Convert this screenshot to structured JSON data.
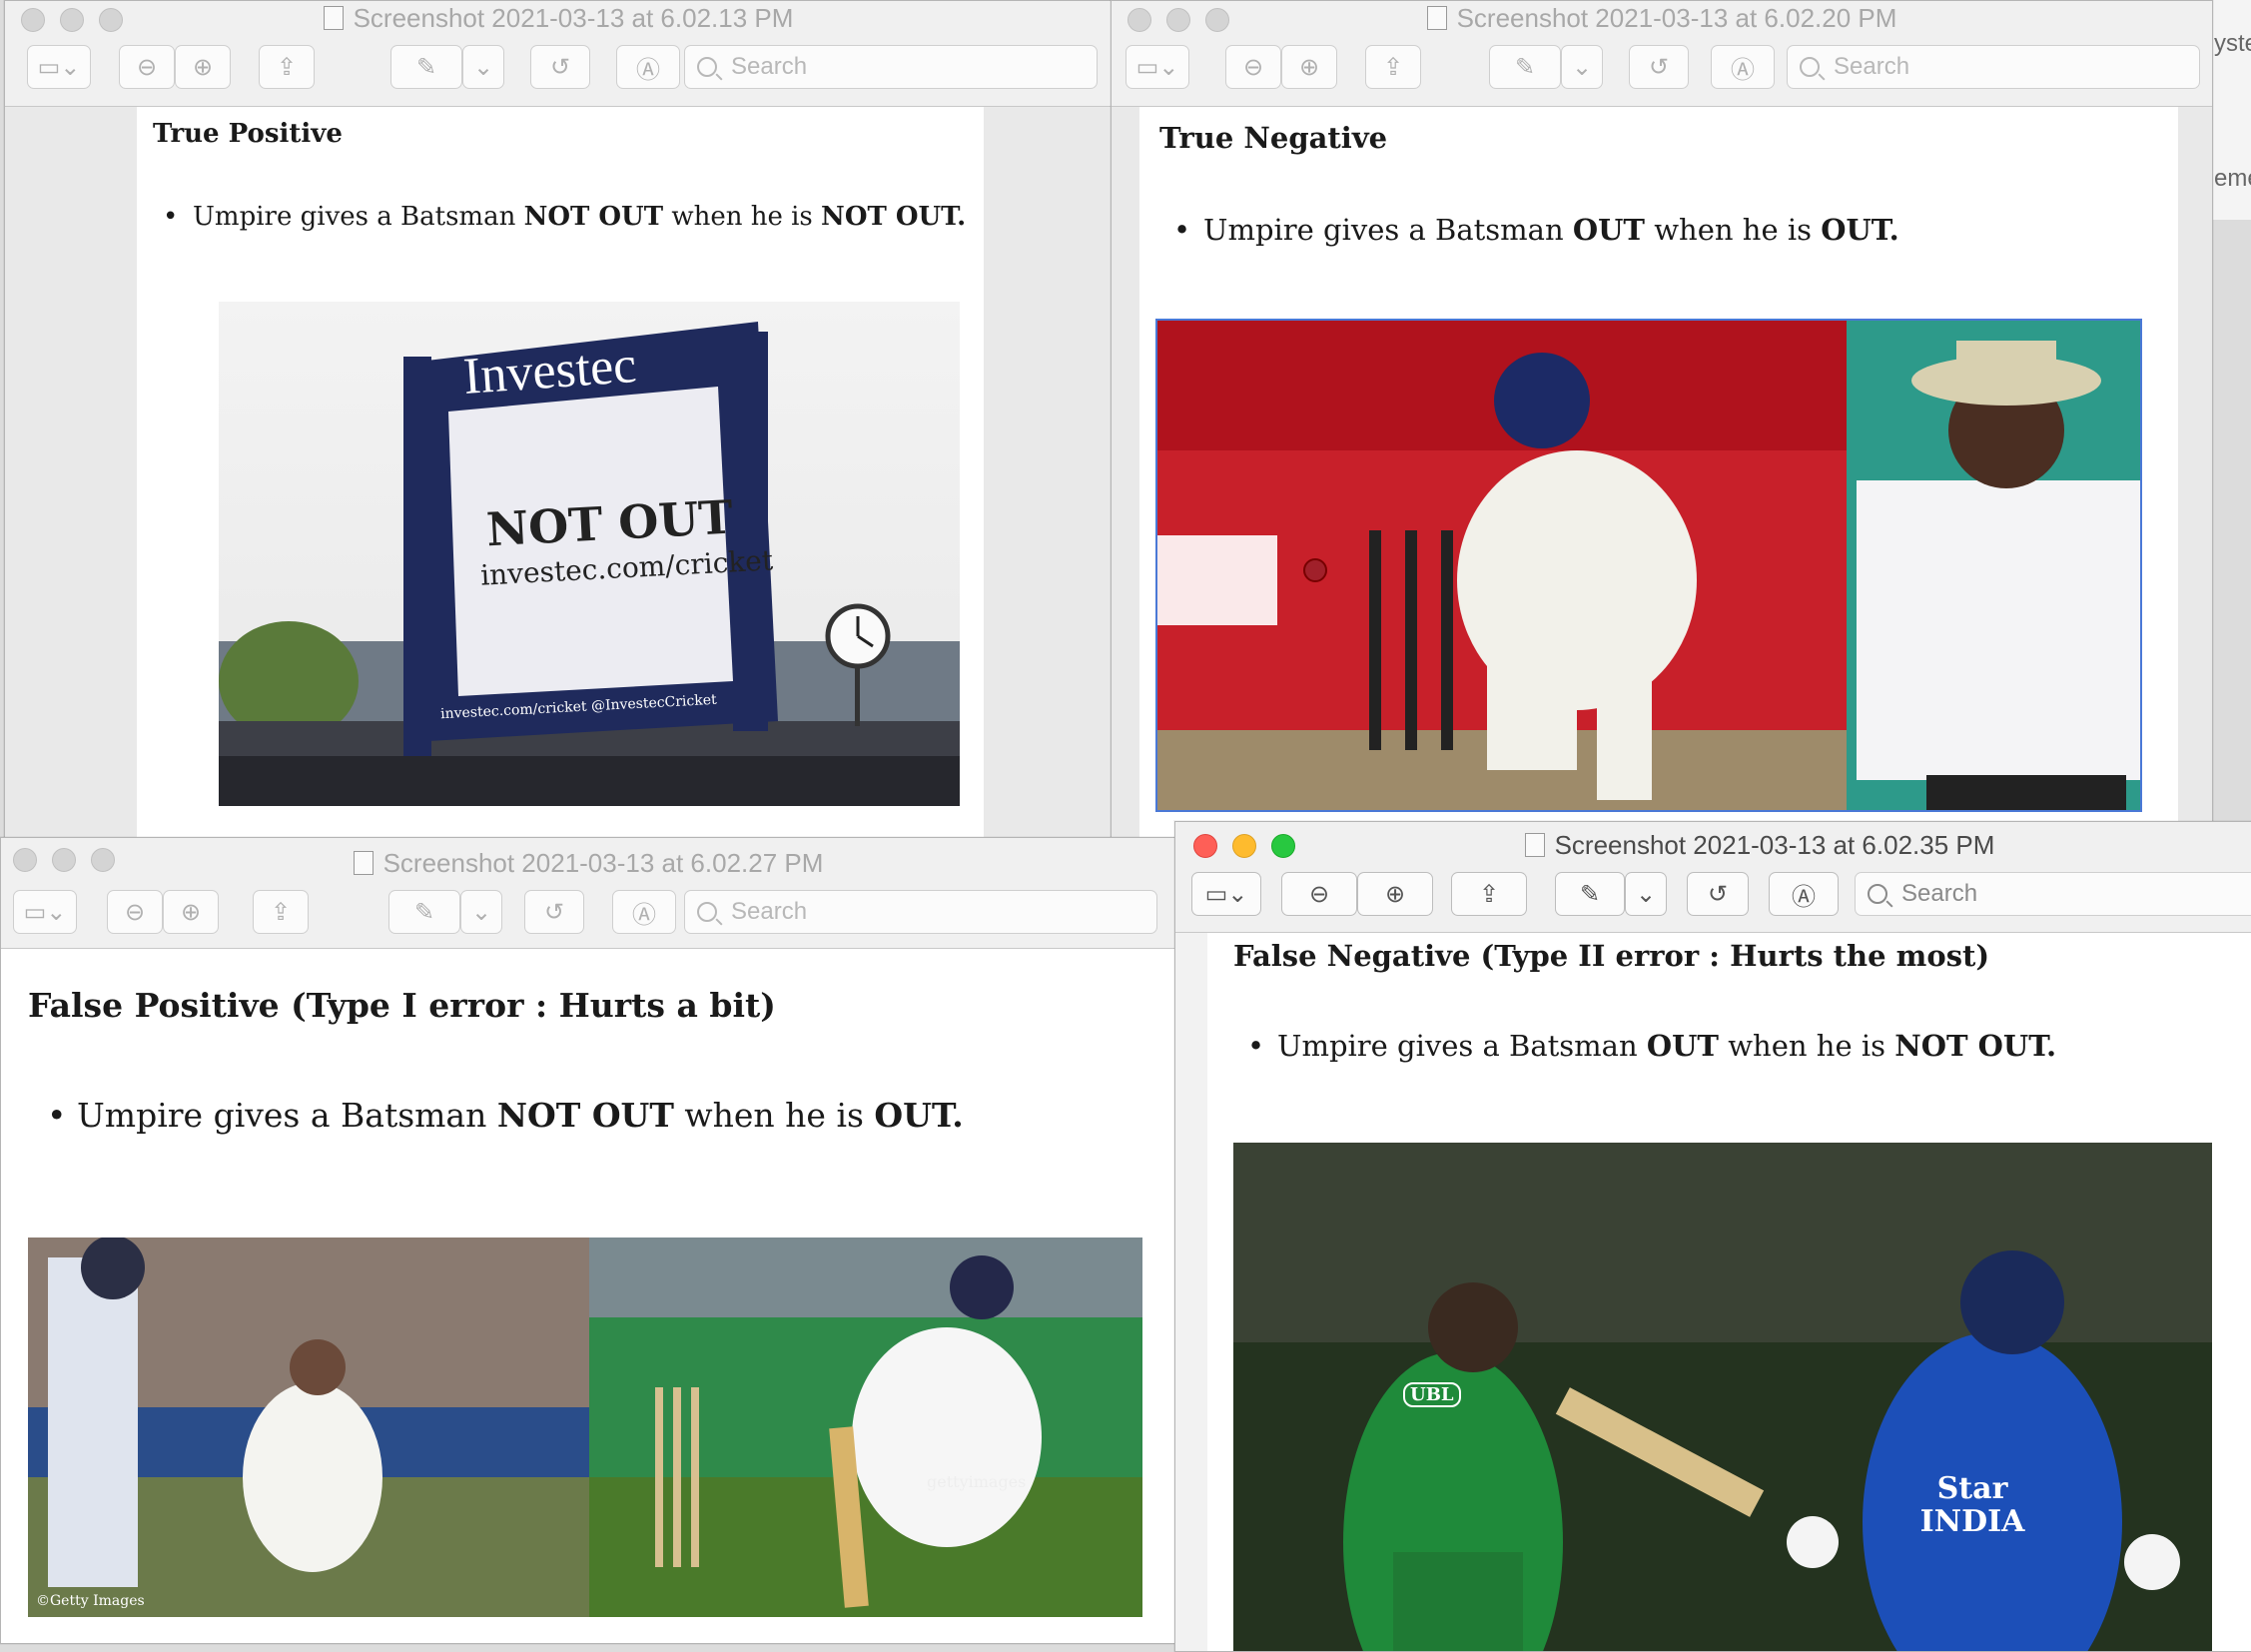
{
  "windows": {
    "w1": {
      "title": "Screenshot 2021-03-13 at 6.02.13 PM",
      "heading": "True Positive",
      "pre": "Umpire gives a Batsman ",
      "b1": "NOT OUT",
      "mid": " when he is ",
      "b2": "NOT OUT."
    },
    "w2": {
      "title": "Screenshot 2021-03-13 at 6.02.20 PM",
      "heading": "True Negative",
      "pre": "Umpire gives a Batsman ",
      "b1": "OUT",
      "mid": " when he is ",
      "b2": "OUT."
    },
    "w3": {
      "title": "Screenshot 2021-03-13 at 6.02.27 PM",
      "heading": "False Positive (Type I error : Hurts a bit)",
      "pre": "Umpire gives a Batsman ",
      "b1": "NOT OUT",
      "mid": " when he is ",
      "b2": "OUT."
    },
    "w4": {
      "title": "Screenshot 2021-03-13 at 6.02.35 PM",
      "heading": "False Negative (Type II error : Hurts the most)",
      "pre": "Umpire gives a Batsman ",
      "b1": "OUT",
      "mid": " when he is ",
      "b2": "NOT OUT."
    }
  },
  "toolbar": {
    "search_placeholder": "Search"
  },
  "images": {
    "scoreboard_brand": "Investec",
    "scoreboard_text": "NOT OUT",
    "scoreboard_url": "investec.com/cricket",
    "scoreboard_bottom": "investec.com/cricket   @InvestecCricket",
    "getty": "©Getty Images",
    "gettyimages": "gettyimages",
    "jersey": "Star INDIA",
    "ubl": "UBL"
  },
  "background_text": {
    "a": "yste",
    "b": "eme"
  },
  "colors": {
    "traffic_red": "#fe5f57",
    "traffic_yellow": "#febb2e",
    "traffic_green": "#28c840",
    "board_navy": "#1f2a5c"
  }
}
